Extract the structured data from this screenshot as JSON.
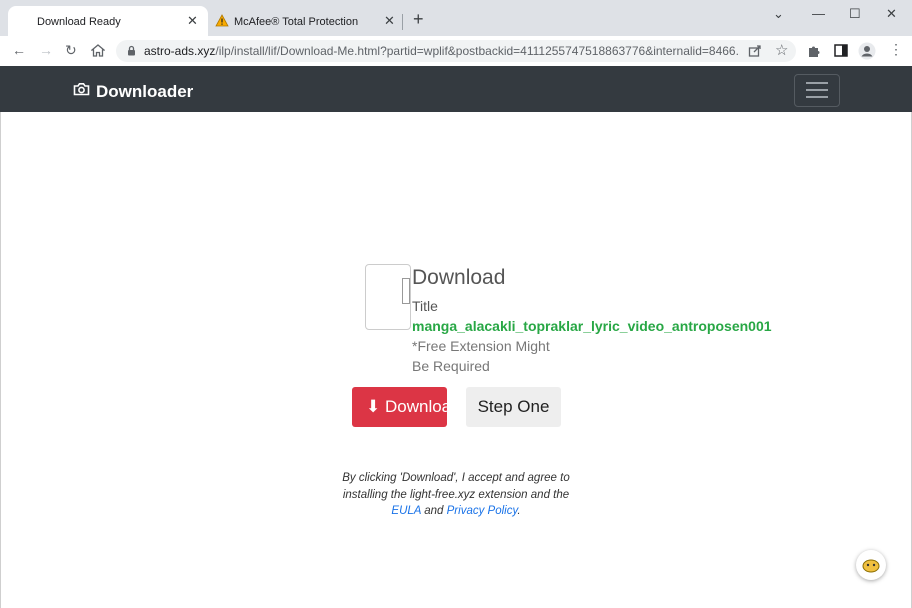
{
  "browser": {
    "tabs": [
      {
        "title": "Download Ready",
        "active": true
      },
      {
        "title": "McAfee® Total Protection",
        "active": false
      }
    ],
    "url": {
      "host": "astro-ads.xyz",
      "path": "/ilp/install/lif/Download-Me.html?partid=wplif&postbackid=4111255747518863776&internalid=8466..."
    }
  },
  "site": {
    "brand": "Downloader",
    "download_heading": "Download",
    "title_label": "Title",
    "filename": "manga_alacakli_topraklar_lyric_video_antroposen001",
    "note": "*Free Extension Might Be Required",
    "download_button": "Download",
    "step_button": "Step One",
    "legal": {
      "text": "By clicking 'Download', I accept and agree to installing the light-free.xyz extension and the",
      "eula": "EULA",
      "and": "and",
      "privacy": "Privacy Policy",
      "end": "."
    }
  },
  "colors": {
    "navbar": "#343a40",
    "download_button": "#dc3545",
    "filename": "#28a745",
    "link": "#1a73e8"
  }
}
